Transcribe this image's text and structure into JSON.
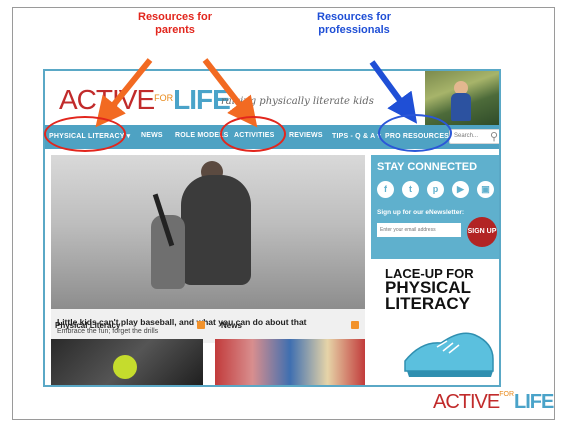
{
  "annotations": {
    "parents_line1": "Resources for",
    "parents_line2": "parents",
    "professionals_line1": "Resources for",
    "professionals_line2": "professionals"
  },
  "site": {
    "logo": {
      "active": "ACTIVE",
      "for": "FOR",
      "life": "LIFE"
    },
    "tagline": "raising physically literate kids",
    "nav": {
      "physical_literacy": "PHYSICAL LITERACY ▾",
      "news": "NEWS",
      "role_models": "ROLE MODELS",
      "activities": "ACTIVITIES",
      "reviews": "REVIEWS",
      "tips": "TIPS - Q & A ▾",
      "pro_resources": "PRO RESOURCES ▾"
    },
    "search": {
      "placeholder": "Search..."
    },
    "hero": {
      "title": "Little kids can't play baseball, and what you can do about that",
      "subtitle": "Embrace the fun; forget the drills"
    },
    "panels": {
      "physical_literacy": "Physical Literacy",
      "news": "News"
    },
    "sidebar": {
      "stay_connected": "STAY CONNECTED",
      "signup_label": "Sign up for our eNewsletter:",
      "email_placeholder": "Enter your email address",
      "signup_button": "SIGN UP"
    },
    "lace_up": {
      "line1": "LACE-UP FOR",
      "line2": "PHYSICAL",
      "line3": "LITERACY"
    }
  },
  "footer_logo": {
    "active": "ACTIVE",
    "for": "FOR",
    "life": "LIFE"
  },
  "colors": {
    "accent_red": "#e2261d",
    "accent_blue": "#2b57d8",
    "nav_blue": "#4ea2c3"
  },
  "icons": [
    "facebook-icon",
    "twitter-icon",
    "pinterest-icon",
    "youtube-icon",
    "instagram-icon",
    "rss-icon",
    "search-icon"
  ]
}
